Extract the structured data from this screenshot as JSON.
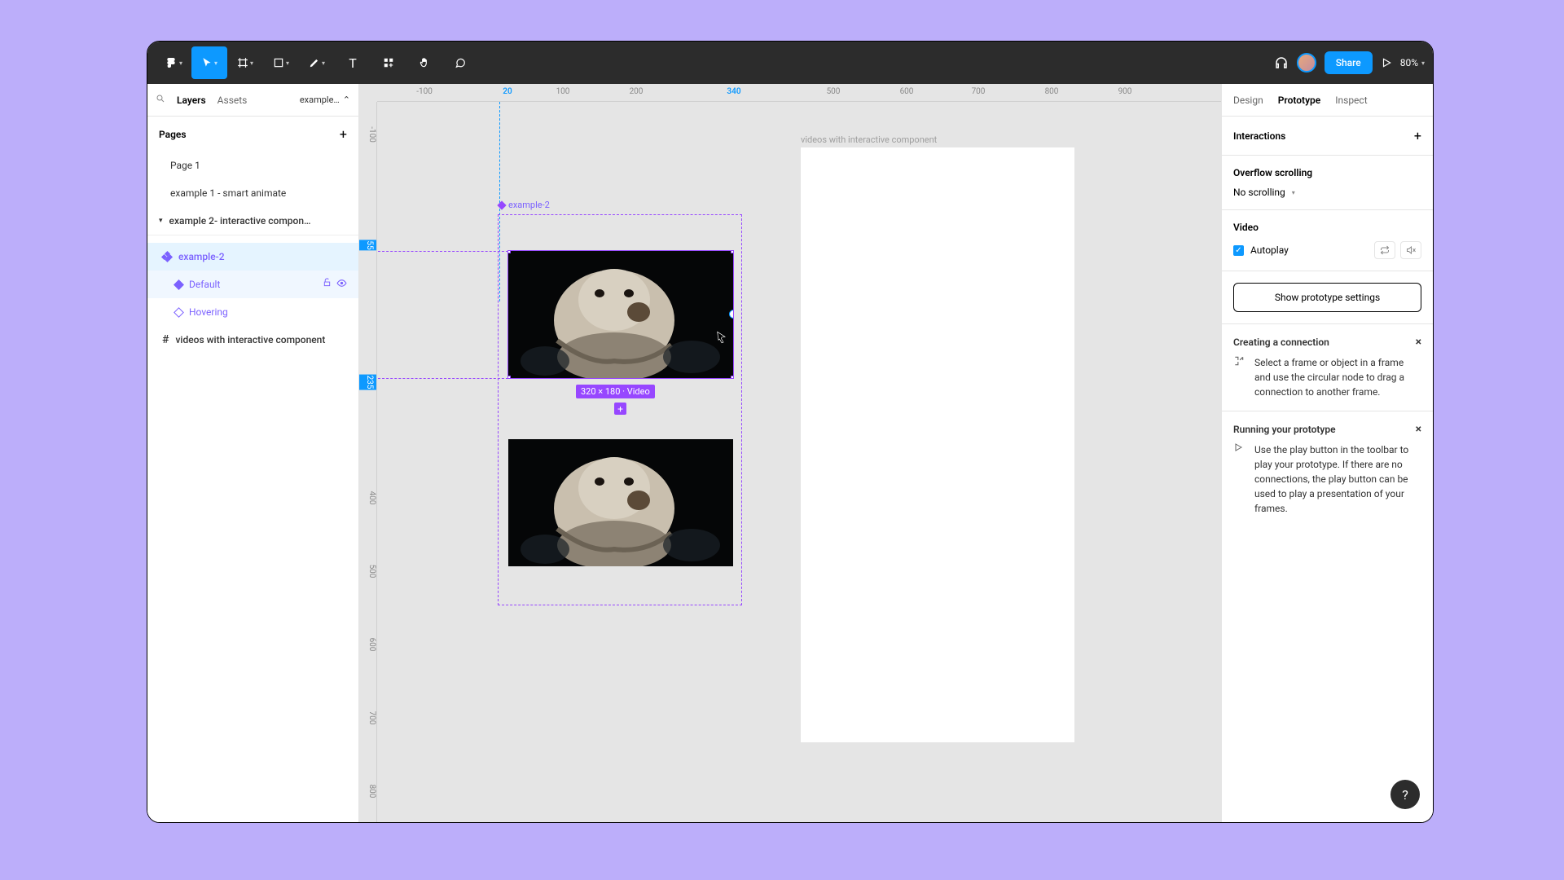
{
  "toolbar": {
    "zoom": "80%",
    "share_label": "Share"
  },
  "left_panel": {
    "tabs": [
      "Layers",
      "Assets"
    ],
    "breadcrumb": "example…",
    "pages_header": "Pages",
    "pages": [
      "Page 1",
      "example 1 - smart animate",
      "example 2- interactive compon…"
    ],
    "layers": {
      "component": "example-2",
      "variants": [
        "Default",
        "Hovering"
      ],
      "frame": "videos with interactive component"
    }
  },
  "canvas": {
    "ruler_h": [
      {
        "label": "-100",
        "pos": 58
      },
      {
        "label": "20",
        "pos": 160,
        "hl": true
      },
      {
        "label": "100",
        "pos": 228
      },
      {
        "label": "200",
        "pos": 318
      },
      {
        "label": "340",
        "pos": 438,
        "hl": true
      },
      {
        "label": "500",
        "pos": 560
      },
      {
        "label": "600",
        "pos": 650
      },
      {
        "label": "700",
        "pos": 738
      },
      {
        "label": "800",
        "pos": 828
      },
      {
        "label": "900",
        "pos": 918
      }
    ],
    "ruler_v": [
      {
        "label": "-100",
        "pos": 40
      },
      {
        "label": "55",
        "pos": 176,
        "badge": true
      },
      {
        "label": "235",
        "pos": 344,
        "badge": true
      },
      {
        "label": "400",
        "pos": 486
      },
      {
        "label": "500",
        "pos": 576
      },
      {
        "label": "600",
        "pos": 666
      },
      {
        "label": "700",
        "pos": 756
      },
      {
        "label": "800",
        "pos": 846
      }
    ],
    "component_label": "example-2",
    "frame_label": "videos with interactive component",
    "dimension_badge": "320 × 180 · Video"
  },
  "right_panel": {
    "tabs": [
      "Design",
      "Prototype",
      "Inspect"
    ],
    "interactions_label": "Interactions",
    "overflow_label": "Overflow scrolling",
    "overflow_value": "No scrolling",
    "video_label": "Video",
    "autoplay_label": "Autoplay",
    "show_settings": "Show prototype settings",
    "tips": [
      {
        "title": "Creating a connection",
        "body": "Select a frame or object in a frame and use the circular node to drag a connection to another frame."
      },
      {
        "title": "Running your prototype",
        "body": "Use the play button in the toolbar to play your prototype. If there are no connections, the play button can be used to play a presentation of your frames."
      }
    ]
  }
}
